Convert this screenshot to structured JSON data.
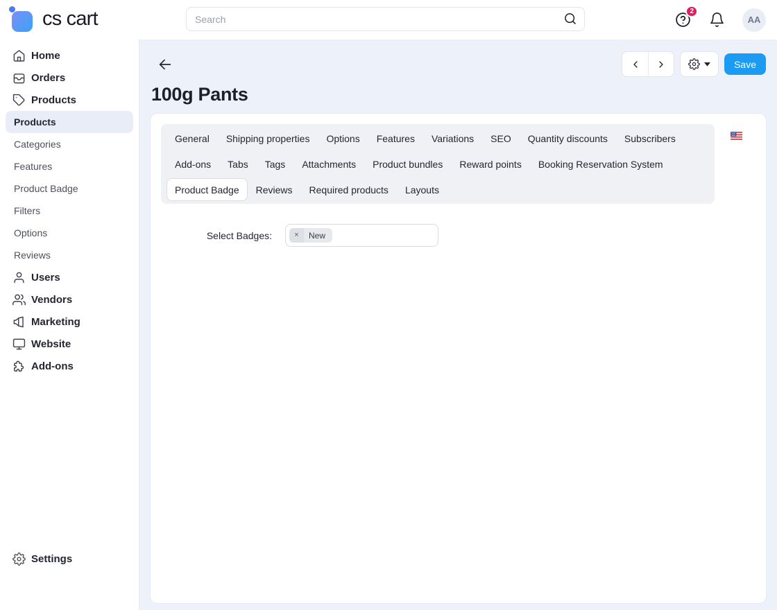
{
  "topbar": {
    "logo_text": "cs cart",
    "search": {
      "placeholder": "Search"
    },
    "help_badge_count": "2",
    "avatar_initials": "AA"
  },
  "sidebar": {
    "top_items": [
      {
        "label": "Home"
      },
      {
        "label": "Orders"
      },
      {
        "label": "Products"
      }
    ],
    "products_submenu": [
      {
        "label": "Products",
        "active": true
      },
      {
        "label": "Categories"
      },
      {
        "label": "Features"
      },
      {
        "label": "Product Badge"
      },
      {
        "label": "Filters"
      },
      {
        "label": "Options"
      },
      {
        "label": "Reviews"
      }
    ],
    "bottom_items": [
      {
        "label": "Users"
      },
      {
        "label": "Vendors"
      },
      {
        "label": "Marketing"
      },
      {
        "label": "Website"
      },
      {
        "label": "Add-ons"
      }
    ],
    "settings_label": "Settings"
  },
  "toolbar": {
    "save_label": "Save"
  },
  "page": {
    "title": "100g Pants"
  },
  "tabs": {
    "row1": [
      "General",
      "Shipping properties",
      "Options",
      "Features",
      "Variations",
      "SEO",
      "Quantity discounts",
      "Subscribers",
      "Add-ons"
    ],
    "row2": [
      "Tabs",
      "Tags",
      "Attachments",
      "Product bundles",
      "Reward points",
      "Booking Reservation System",
      "Product Badge"
    ],
    "row3": [
      "Reviews",
      "Required products",
      "Layouts"
    ],
    "active_tab": "Product Badge",
    "language_flag": "us-flag"
  },
  "form": {
    "select_badges_label": "Select Badges:",
    "selected_badges": [
      {
        "label": "New",
        "remove_icon": "×"
      }
    ]
  },
  "colors": {
    "accent_blue": "#1b9bf3",
    "badge_red": "#dc1d5f",
    "main_bg": "#edf1f9",
    "tabbar_bg": "#f0f1f5",
    "active_pill_bg": "#e9edf7"
  }
}
